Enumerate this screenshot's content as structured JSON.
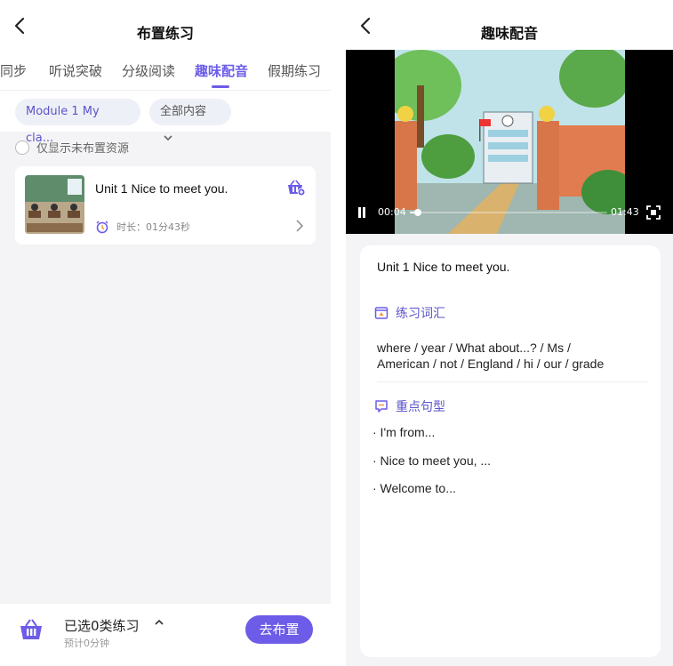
{
  "left": {
    "header": {
      "title": "布置练习"
    },
    "tabs": [
      {
        "label": "同步"
      },
      {
        "label": "听说突破"
      },
      {
        "label": "分级阅读"
      },
      {
        "label": "趣味配音"
      },
      {
        "label": "假期练习"
      }
    ],
    "filters": {
      "module": "Module 1 My cla...",
      "content": "全部内容"
    },
    "only_unassigned": "仅显示未布置资源",
    "card": {
      "title": "Unit 1 Nice to meet you.",
      "duration": "时长：01分43秒"
    },
    "bottom": {
      "selected": "已选0类练习",
      "estimate": "预计0分钟",
      "assign_button": "去布置"
    }
  },
  "right": {
    "header": {
      "title": "趣味配音"
    },
    "video": {
      "current_time": "00:04",
      "total_time": "01:43",
      "progress": 0.04
    },
    "panel": {
      "title": "Unit 1 Nice to meet you.",
      "vocab_heading": "练习词汇",
      "vocab_line1": "where /  year /  What about...? /  Ms /",
      "vocab_line2": "American /  not /  England /  hi /  our /  grade",
      "sentence_heading": "重点句型",
      "sentences": [
        "· I'm from...",
        "· Nice to meet you, ...",
        "· Welcome to..."
      ]
    }
  },
  "colors": {
    "accent": "#6c5ce7",
    "chip_bg": "#eef0f7",
    "page_bg": "#f4f4f6"
  }
}
